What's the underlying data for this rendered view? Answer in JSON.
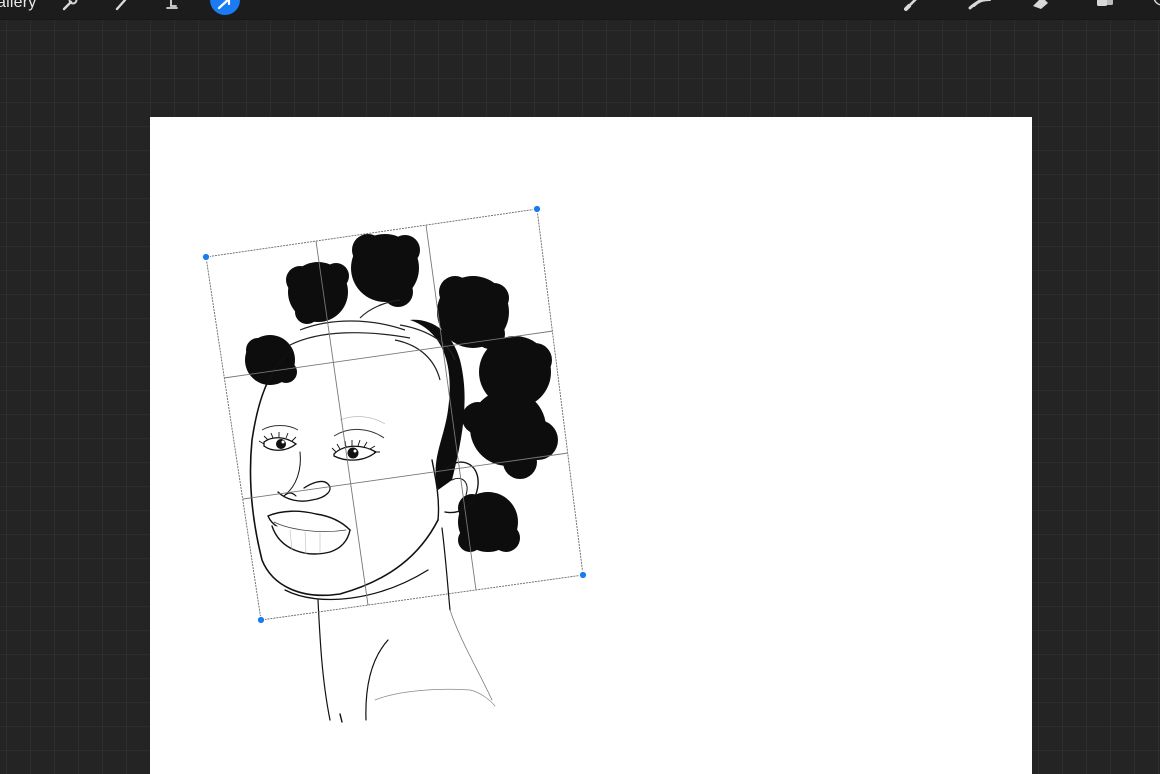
{
  "toolbar": {
    "gallery_label": "allery",
    "left_tools": [
      "wrench-icon",
      "magic-wand-icon",
      "selection-icon",
      "transform-arrow-icon"
    ],
    "right_tools": [
      "brush-icon",
      "smudge-icon",
      "eraser-icon",
      "layers-icon"
    ]
  },
  "canvas": {
    "background": "#ffffff",
    "workspace_background": "#242424"
  },
  "transform": {
    "mode": "distort",
    "grid": "3x3",
    "handle_color": "#1a7bf2"
  },
  "colors": {
    "accent": "#1a7bf2",
    "toolbar": "#1c1c1c",
    "icon": "#d8d8d8"
  }
}
